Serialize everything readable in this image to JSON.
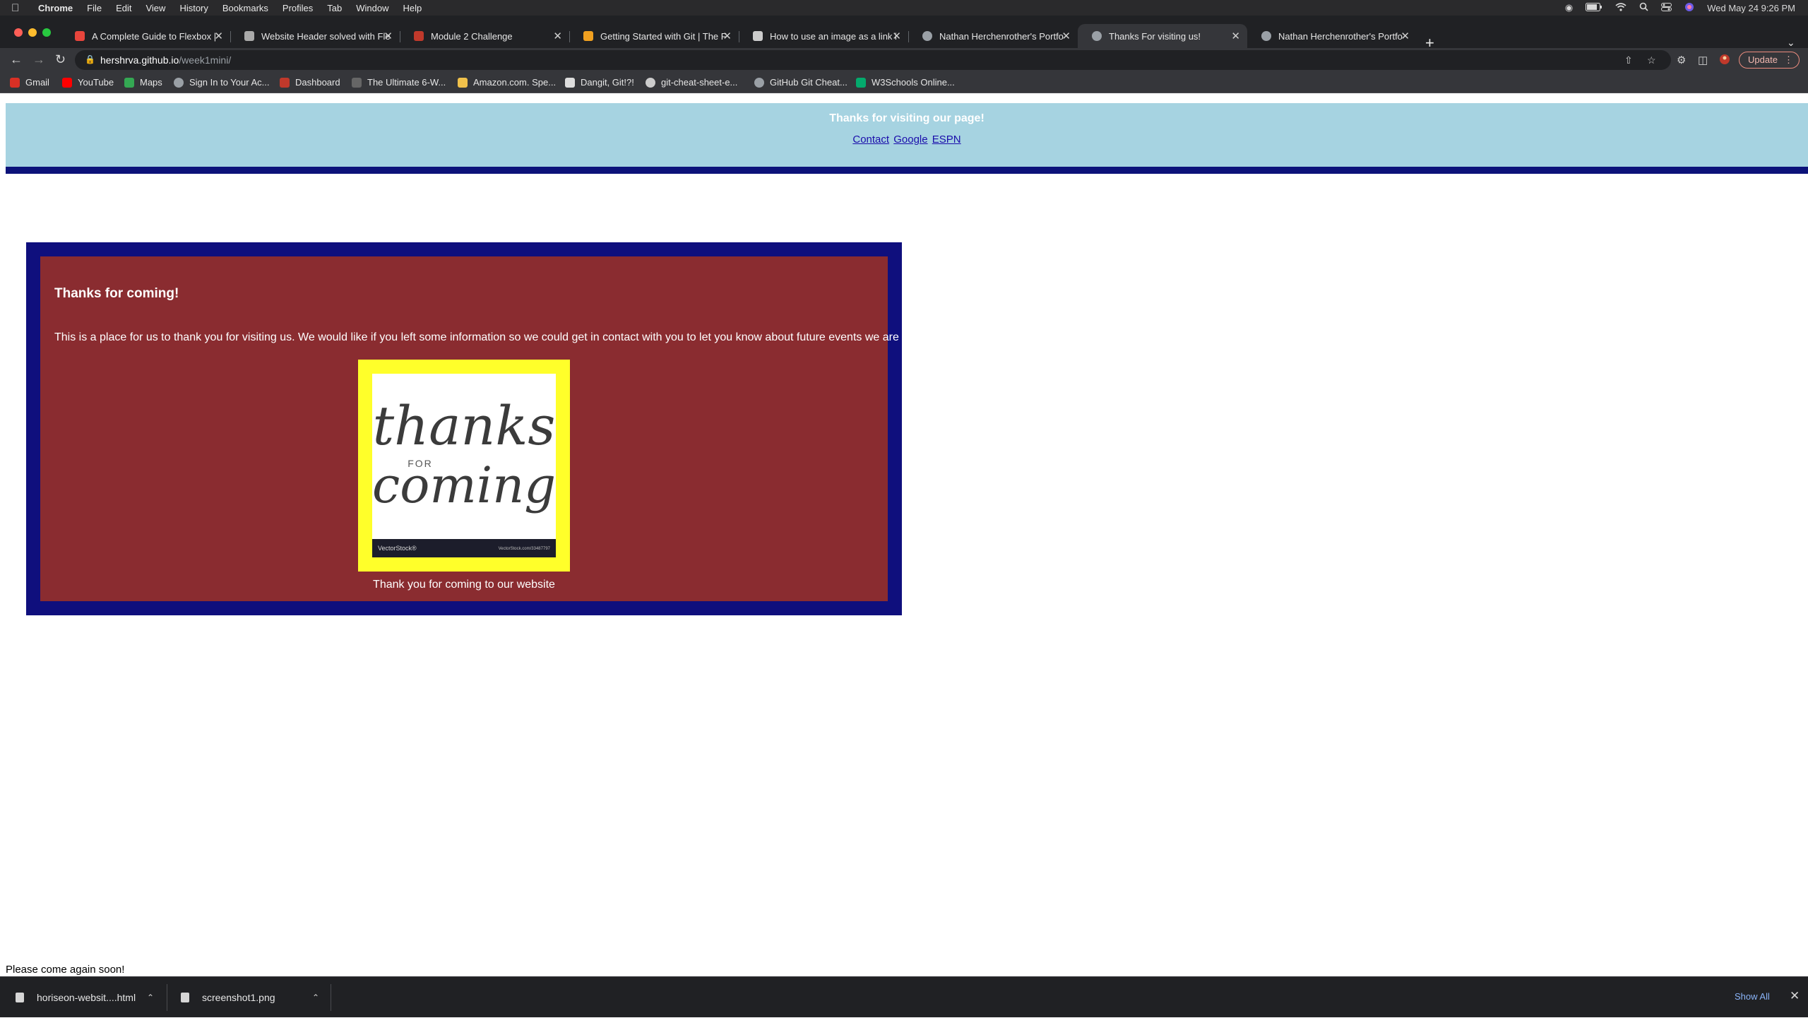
{
  "menubar": {
    "app_name": "Chrome",
    "menus": [
      "File",
      "Edit",
      "View",
      "History",
      "Bookmarks",
      "Profiles",
      "Tab",
      "Window",
      "Help"
    ],
    "clock": "Wed May 24  9:26 PM"
  },
  "tabs": [
    {
      "title": "A Complete Guide to Flexbox |",
      "icon_color": "#e8453c",
      "active": false
    },
    {
      "title": "Website Header solved with Fle",
      "icon_color": "#aaaaaa",
      "active": false
    },
    {
      "title": "Module 2 Challenge",
      "icon_color": "#c0392b",
      "active": false
    },
    {
      "title": "Getting Started with Git | The F",
      "icon_color": "#f0a020",
      "active": false
    },
    {
      "title": "How to use an image as a link i",
      "icon_color": "#cccccc",
      "active": false
    },
    {
      "title": "Nathan Herchenrother's Portfo",
      "icon_color": "#9aa0a6",
      "active": false
    },
    {
      "title": "Thanks For visiting us!",
      "icon_color": "#9aa0a6",
      "active": true
    },
    {
      "title": "Nathan Herchenrother's Portfo",
      "icon_color": "#9aa0a6",
      "active": false
    }
  ],
  "toolbar": {
    "url_host": "hershrva.github.io",
    "url_path": "/week1mini/",
    "update_label": "Update"
  },
  "bookmarks": [
    {
      "label": "Gmail",
      "icon_color": "#d93025"
    },
    {
      "label": "YouTube",
      "icon_color": "#ff0000"
    },
    {
      "label": "Maps",
      "icon_color": "#34a853"
    },
    {
      "label": "Sign In to Your Ac...",
      "icon_color": "#9aa0a6"
    },
    {
      "label": "Dashboard",
      "icon_color": "#c0392b"
    },
    {
      "label": "The Ultimate 6-W...",
      "icon_color": "#666666"
    },
    {
      "label": "Amazon.com. Spe...",
      "icon_color": "#f0c14b"
    },
    {
      "label": "Dangit, Git!?!",
      "icon_color": "#dddddd"
    },
    {
      "label": "git-cheat-sheet-e...",
      "icon_color": "#cccccc"
    },
    {
      "label": "GitHub Git Cheat...",
      "icon_color": "#9aa0a6"
    },
    {
      "label": "W3Schools Online...",
      "icon_color": "#04aa6d"
    }
  ],
  "site": {
    "header_title": "Thanks for visiting our page!",
    "nav": [
      "Contact",
      "Google",
      "ESPN"
    ],
    "heading": "Thanks for coming!",
    "intro": "This is a place for us to thank you for visiting us. We would like if you left some information so we could get in contact with you to let you know about future events we are holding!",
    "image": {
      "line1": "thanks",
      "line2": "FOR",
      "line3": "coming",
      "watermark_left": "VectorStock®",
      "watermark_right": "VectorStock.com/33487797"
    },
    "caption": "Thank you for coming to our website",
    "footer": "Please come again soon!",
    "colors": {
      "header_bg": "#a6d3e1",
      "header_bar": "#0c1279",
      "outer_box": "#0f0f7d",
      "inner_box": "#8a2c30",
      "photo_frame": "#ffff2a"
    }
  },
  "downloads": {
    "items": [
      "horiseon-websit....html",
      "screenshot1.png"
    ],
    "show_all": "Show All"
  }
}
